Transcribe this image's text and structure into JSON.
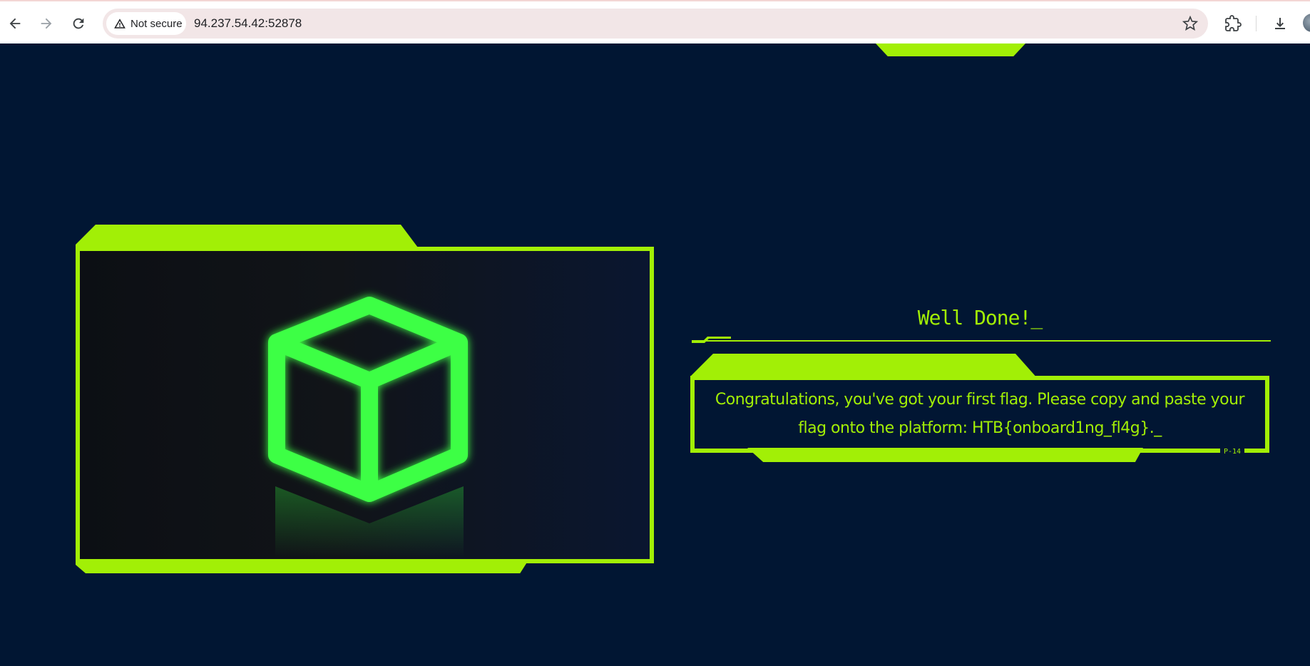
{
  "browser": {
    "security_label": "Not secure",
    "url": "94.237.54.42:52878"
  },
  "page": {
    "title": "Well Done!_",
    "message": "Congratulations, you've got your first flag. Please copy and paste your flag onto the platform: HTB{onboard1ng_fl4g}._",
    "badge": "P-14",
    "accent_color": "#a2ef06",
    "background_color": "#011633"
  },
  "image": {
    "subject": "glowing green cube",
    "glow_color": "#39ff3a"
  },
  "icons": {
    "back": "back-arrow-icon",
    "forward": "forward-arrow-icon",
    "reload": "reload-icon",
    "warning": "warning-icon",
    "bookmark": "star-icon",
    "extensions": "puzzle-icon",
    "download": "download-icon"
  }
}
